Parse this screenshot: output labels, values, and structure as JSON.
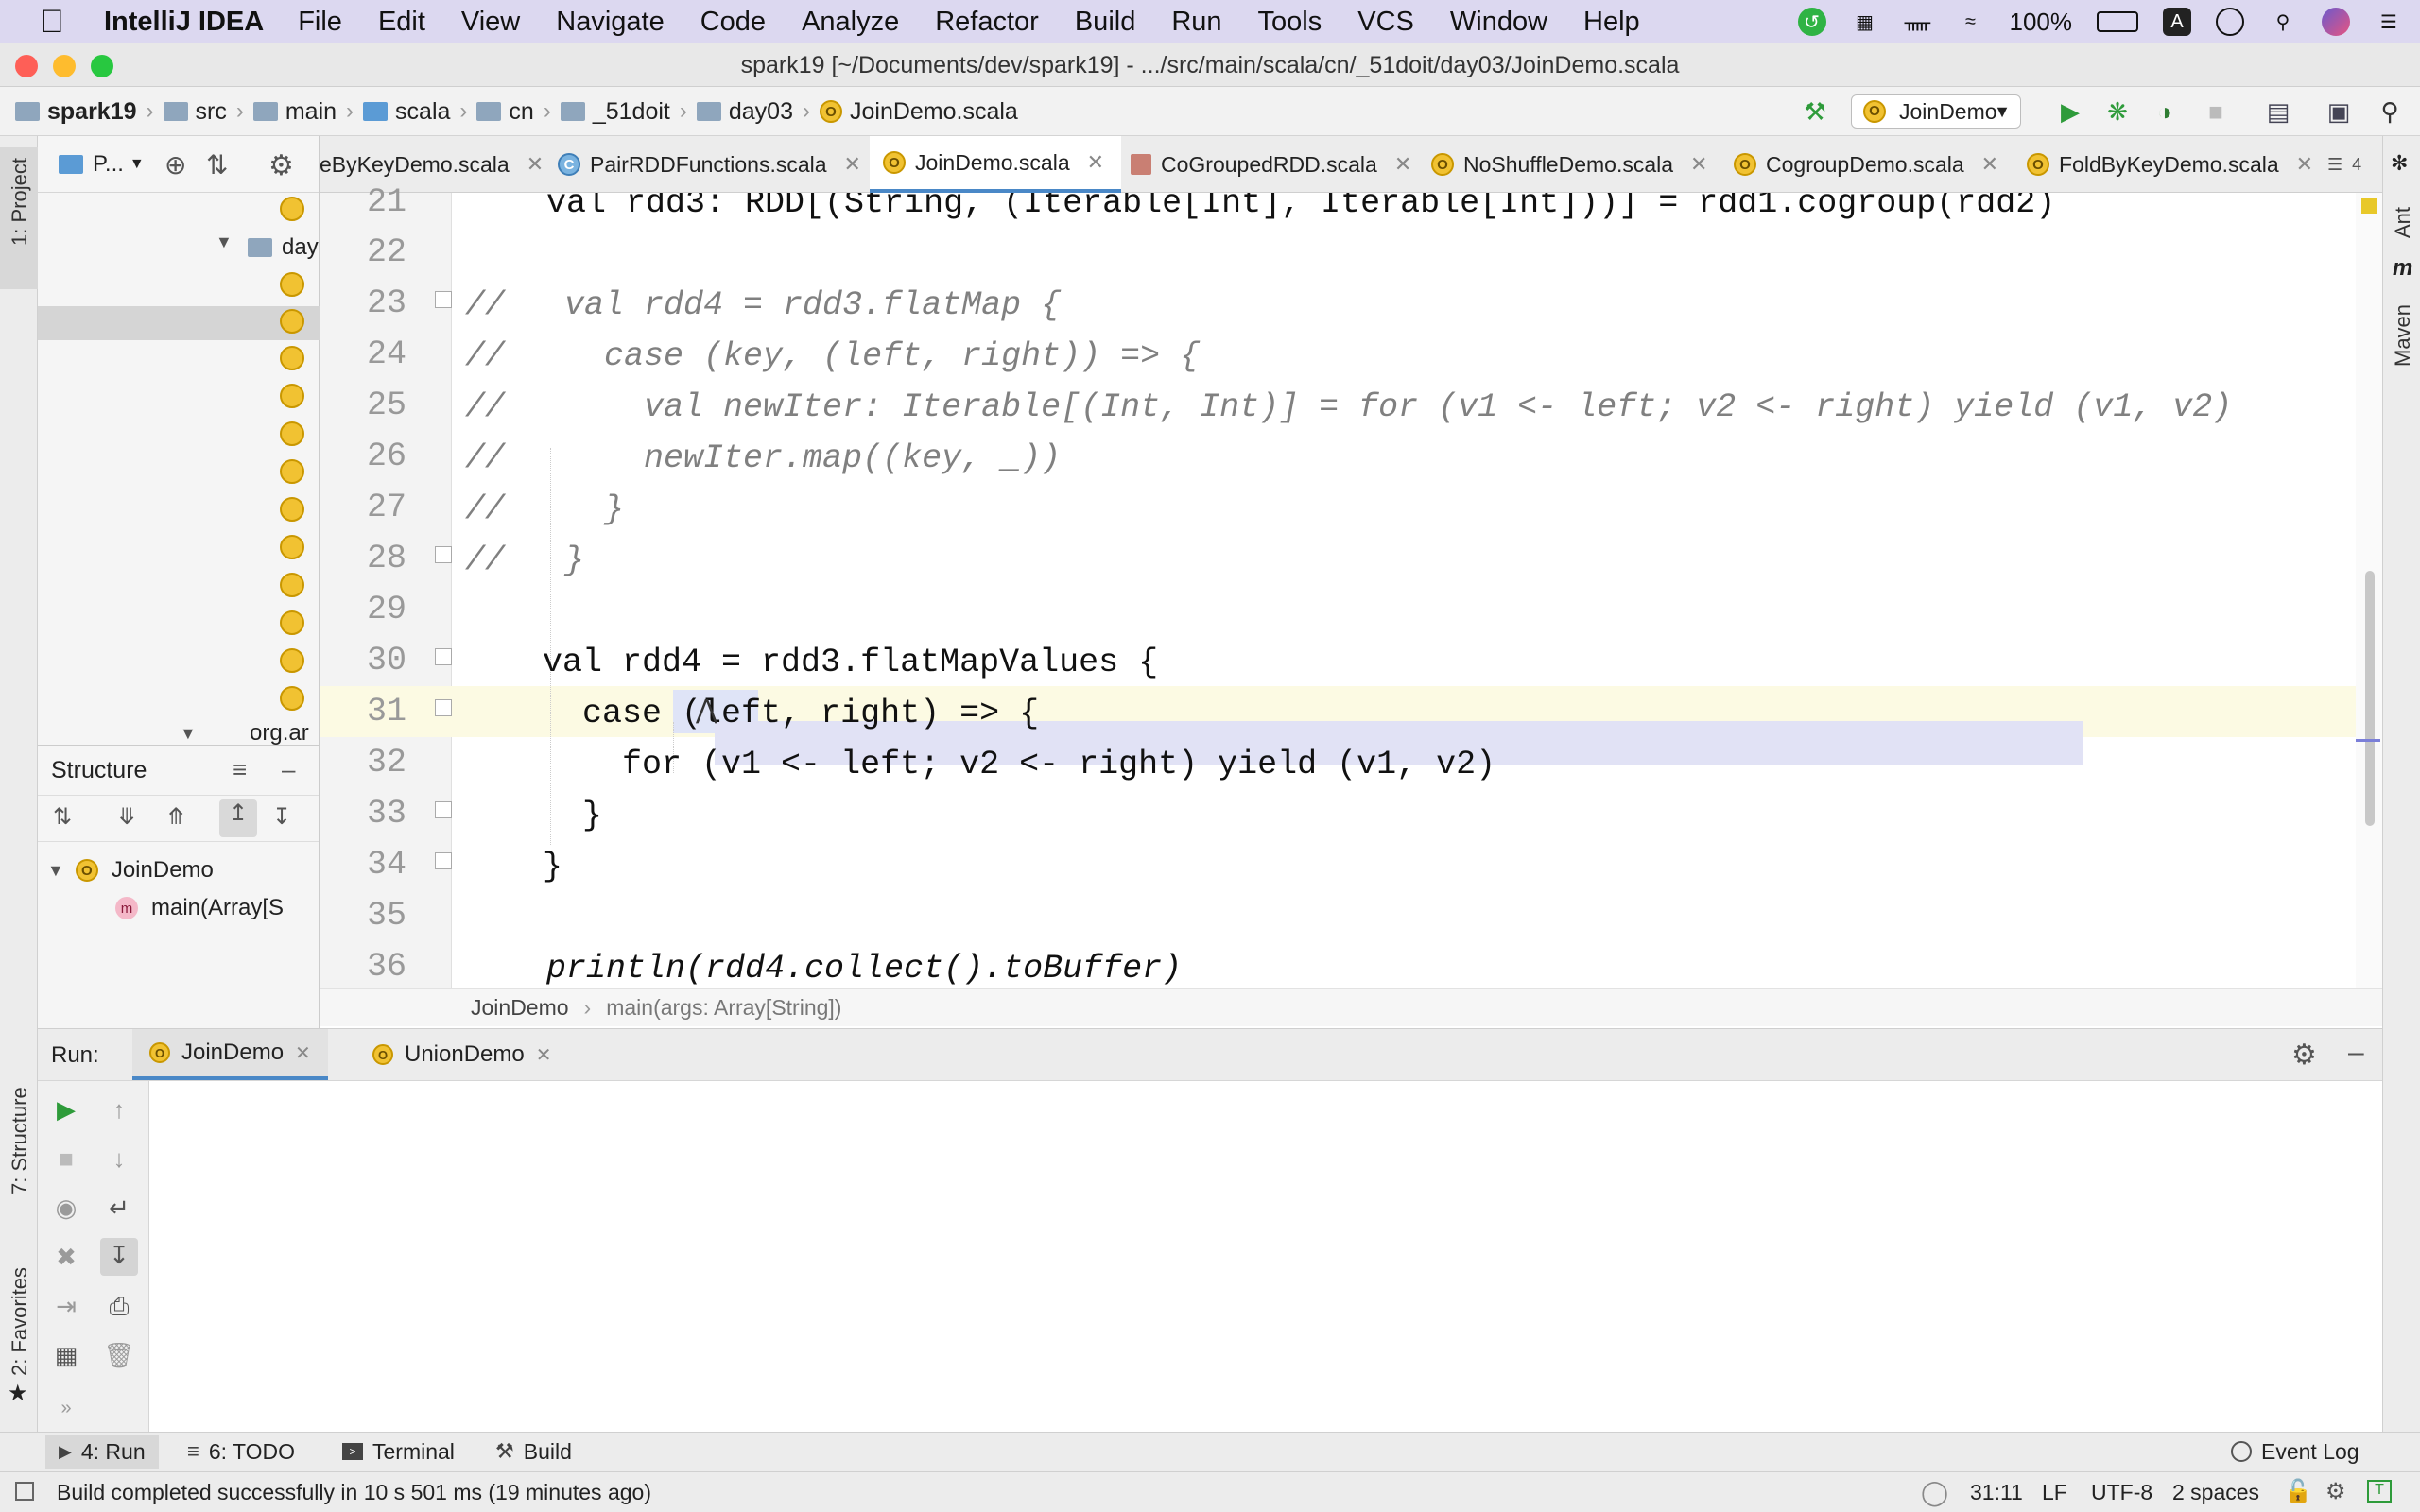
{
  "menubar": {
    "app_name": "IntelliJ IDEA",
    "items": [
      "File",
      "Edit",
      "View",
      "Navigate",
      "Code",
      "Analyze",
      "Refactor",
      "Build",
      "Run",
      "Tools",
      "VCS",
      "Window",
      "Help"
    ],
    "battery": "100%"
  },
  "window": {
    "title": "spark19 [~/Documents/dev/spark19] - .../src/main/scala/cn/_51doit/day03/JoinDemo.scala"
  },
  "navbar": {
    "crumbs": [
      "spark19",
      "src",
      "main",
      "scala",
      "cn",
      "_51doit",
      "day03",
      "JoinDemo.scala"
    ],
    "run_config": "JoinDemo"
  },
  "left_strip": {
    "project_label": "1: Project",
    "structure_label": "7: Structure",
    "favorites_label": "2: Favorites"
  },
  "project_panel": {
    "title": "P...",
    "tree_day": "day",
    "tree_org": "org.ar"
  },
  "structure_panel": {
    "title": "Structure",
    "class_name": "JoinDemo",
    "method": "main(Array[S"
  },
  "tabs": [
    {
      "label": "eByKeyDemo.scala"
    },
    {
      "label": "PairRDDFunctions.scala"
    },
    {
      "label": "JoinDemo.scala"
    },
    {
      "label": "CoGroupedRDD.scala"
    },
    {
      "label": "NoShuffleDemo.scala"
    },
    {
      "label": "CogroupDemo.scala"
    },
    {
      "label": "FoldByKeyDemo.scala"
    }
  ],
  "tabs_overflow": "4",
  "right_strip": {
    "ant": "Ant",
    "maven": "Maven"
  },
  "editor": {
    "line_numbers": [
      "21",
      "22",
      "23",
      "24",
      "25",
      "26",
      "27",
      "28",
      "29",
      "30",
      "31",
      "32",
      "33",
      "34",
      "35",
      "36"
    ],
    "lines": {
      "l21": "val rdd3: RDD[(String, (Iterable[Int], Iterable[Int]))] = rdd1.cogroup(rdd2)",
      "l23": "//   val rdd4 = rdd3.flatMap {",
      "l24": "//     case (key, (left, right)) => {",
      "l25": "//       val newIter: Iterable[(Int, Int)] = for (v1 <- left; v2 <- right) yield (v1, v2)",
      "l26": "//       newIter.map((key, _))",
      "l27": "//     }",
      "l28": "//   }",
      "l30": "    val rdd4 = rdd3.flatMapValues {",
      "l31": "      case (left, right) => {",
      "l32": "        for (v1 <- left; v2 <- right) yield (v1, v2)",
      "l33": "      }",
      "l34": "    }",
      "l36": "println(rdd4.collect().toBuffer)"
    }
  },
  "editor_breadcrumb": {
    "class_name": "JoinDemo",
    "method": "main(args: Array[String])"
  },
  "run_panel": {
    "label": "Run:",
    "tabs": [
      "JoinDemo",
      "UnionDemo"
    ]
  },
  "bottom_tools": {
    "run": "4: Run",
    "todo": "6: TODO",
    "terminal": "Terminal",
    "build": "Build",
    "event_log": "Event Log"
  },
  "status": {
    "message": "Build completed successfully in 10 s 501 ms (19 minutes ago)",
    "position": "31:11",
    "line_sep": "LF",
    "encoding": "UTF-8",
    "indent": "2 spaces"
  }
}
